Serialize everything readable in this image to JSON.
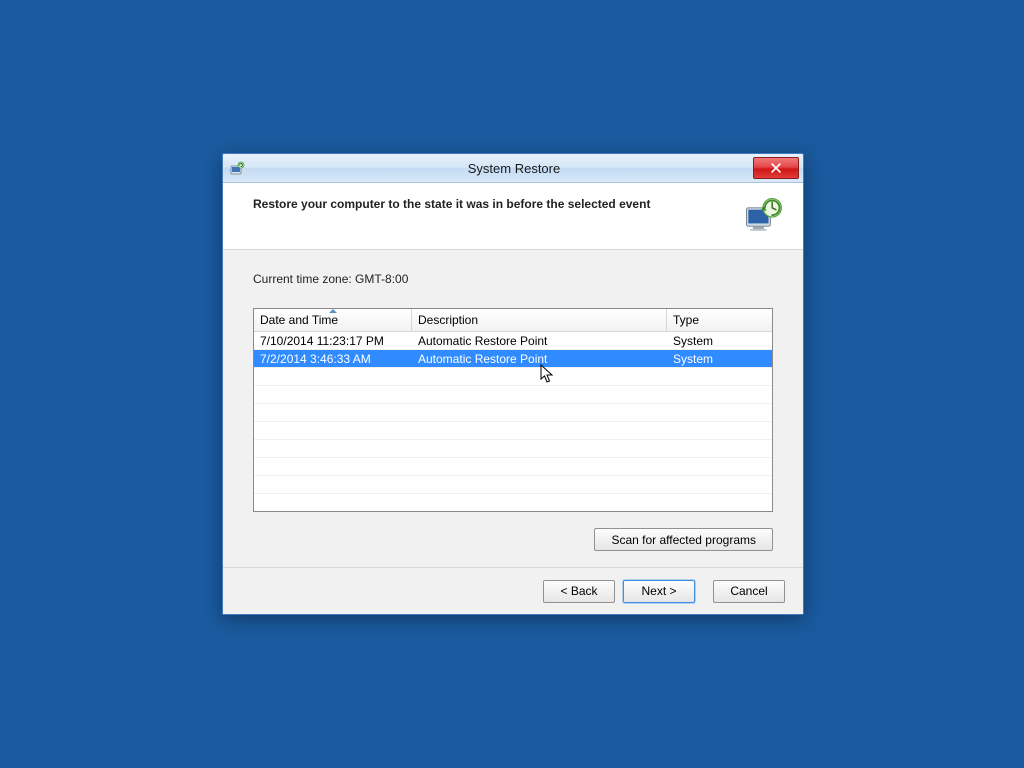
{
  "window": {
    "title": "System Restore",
    "heading": "Restore your computer to the state it was in before the selected event",
    "timezone": "Current time zone: GMT-8:00"
  },
  "columns": {
    "date": "Date and Time",
    "desc": "Description",
    "type": "Type"
  },
  "rows": [
    {
      "date": "7/10/2014 11:23:17 PM",
      "desc": "Automatic Restore Point",
      "type": "System",
      "selected": false
    },
    {
      "date": "7/2/2014 3:46:33 AM",
      "desc": "Automatic Restore Point",
      "type": "System",
      "selected": true
    }
  ],
  "buttons": {
    "scan": "Scan for affected programs",
    "back": "< Back",
    "next": "Next >",
    "cancel": "Cancel"
  }
}
